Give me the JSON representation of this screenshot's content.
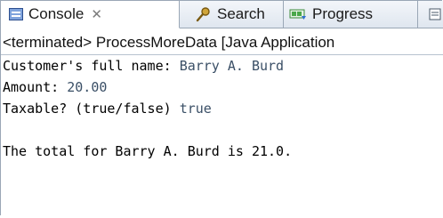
{
  "tabs": [
    {
      "label": "Console",
      "close_glyph": "✕",
      "icon": "console-icon"
    },
    {
      "label": "Search",
      "icon": "search-icon"
    },
    {
      "label": "Progress",
      "icon": "progress-icon"
    }
  ],
  "status": "<terminated> ProcessMoreData [Java Application",
  "console": {
    "lines": [
      {
        "prompt": "Customer's full name: ",
        "value": "Barry A. Burd"
      },
      {
        "prompt": "Amount: ",
        "value": "20.00"
      },
      {
        "prompt": "Taxable? (true/false) ",
        "value": "true"
      },
      {
        "prompt": "",
        "value": ""
      },
      {
        "prompt": "The total for Barry A. Burd is 21.0.",
        "value": ""
      }
    ]
  }
}
